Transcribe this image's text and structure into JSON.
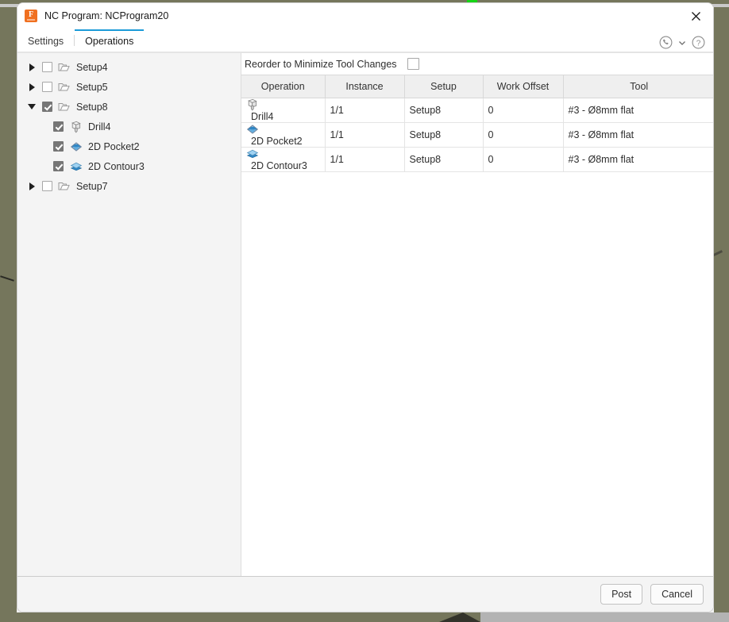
{
  "window": {
    "title": "NC Program: NCProgram20",
    "app_icon": "fusion-app-icon",
    "app_icon_letter": "F",
    "close_label": "✕"
  },
  "tabs": [
    {
      "label": "Settings",
      "active": false
    },
    {
      "label": "Operations",
      "active": true
    }
  ],
  "header_icons": [
    {
      "name": "call-support-icon"
    },
    {
      "name": "chevron-down-icon"
    },
    {
      "name": "help-icon"
    }
  ],
  "tree": {
    "items": [
      {
        "label": "Setup4",
        "level": 0,
        "twisty": "right",
        "checked": false,
        "icon": "folder-icon"
      },
      {
        "label": "Setup5",
        "level": 0,
        "twisty": "right",
        "checked": false,
        "icon": "folder-icon"
      },
      {
        "label": "Setup8",
        "level": 0,
        "twisty": "down",
        "checked": true,
        "icon": "folder-icon"
      },
      {
        "label": "Drill4",
        "level": 1,
        "twisty": "none",
        "checked": true,
        "icon": "drill-icon"
      },
      {
        "label": "2D Pocket2",
        "level": 1,
        "twisty": "none",
        "checked": true,
        "icon": "pocket-icon"
      },
      {
        "label": "2D Contour3",
        "level": 1,
        "twisty": "none",
        "checked": true,
        "icon": "contour-icon"
      },
      {
        "label": "Setup7",
        "level": 0,
        "twisty": "right",
        "checked": false,
        "icon": "folder-icon"
      }
    ]
  },
  "options": {
    "reorder_label": "Reorder to Minimize Tool Changes",
    "reorder_checked": false
  },
  "table": {
    "columns": [
      "Operation",
      "Instance",
      "Setup",
      "Work Offset",
      "Tool"
    ],
    "rows": [
      {
        "icon": "drill-icon",
        "operation": "Drill4",
        "instance": "1/1",
        "setup": "Setup8",
        "work_offset": "0",
        "tool": "#3 - Ø8mm flat"
      },
      {
        "icon": "pocket-icon",
        "operation": "2D Pocket2",
        "instance": "1/1",
        "setup": "Setup8",
        "work_offset": "0",
        "tool": "#3 - Ø8mm flat"
      },
      {
        "icon": "contour-icon",
        "operation": "2D Contour3",
        "instance": "1/1",
        "setup": "Setup8",
        "work_offset": "0",
        "tool": "#3 - Ø8mm flat"
      }
    ]
  },
  "footer": {
    "post_label": "Post",
    "cancel_label": "Cancel"
  },
  "colors": {
    "accent_tab": "#1b9bd8",
    "app_icon": "#f07020",
    "desktop": "#75765c",
    "header_row": "#efefef"
  }
}
